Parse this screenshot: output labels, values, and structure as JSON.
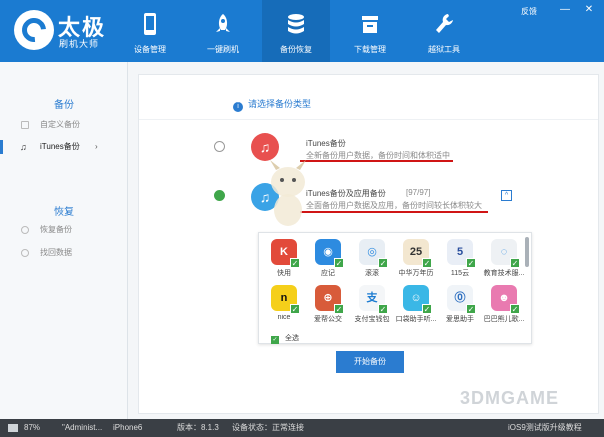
{
  "brand": {
    "title": "太极",
    "subtitle": "刷机大师"
  },
  "nav": [
    {
      "label": "设备管理",
      "icon": "phone-icon"
    },
    {
      "label": "一键刷机",
      "icon": "rocket-icon"
    },
    {
      "label": "备份恢复",
      "icon": "database-icon"
    },
    {
      "label": "下载管理",
      "icon": "download-box-icon"
    },
    {
      "label": "越狱工具",
      "icon": "wrench-icon"
    }
  ],
  "window": {
    "feedback": "反馈",
    "minimize": "—",
    "close": "✕"
  },
  "sidebar": {
    "backup_head": "备份",
    "backup_items": [
      {
        "label": "自定义备份",
        "icon": "checkbox-icon"
      },
      {
        "label": "iTunes备份",
        "icon": "music-note-icon",
        "chevron": "›"
      }
    ],
    "restore_head": "恢复",
    "restore_items": [
      {
        "label": "恢复备份",
        "icon": "circle-icon"
      },
      {
        "label": "找回数据",
        "icon": "circle-icon"
      }
    ]
  },
  "main": {
    "info": "请选择备份类型",
    "option1": {
      "title": "iTunes备份",
      "desc": "全新备份用户数据，备份时间和体积适中"
    },
    "option2": {
      "title": "iTunes备份及应用备份",
      "count": "[97/97]",
      "desc": "全面备份用户数据及应用，备份时间较长体积较大"
    },
    "apps_row1": [
      "快用",
      "应记",
      "滚滚",
      "中华万年历",
      "115云",
      "教育技术服..."
    ],
    "apps_row2": [
      "nice",
      "爱帮公交",
      "支付宝钱包",
      "口袋助手听...",
      "爱思助手",
      "巴巴熊儿歌..."
    ],
    "select_all": "全选",
    "start_button": "开始备份"
  },
  "status": {
    "battery": "87%",
    "device_name": "\"Administ...",
    "device_model": "iPhone6",
    "version": "版本：8.1.3",
    "device_state": "设备状态：正常连接",
    "right_text": "iOS9测试版升级教程"
  },
  "watermark": "3DMGAME",
  "colors": {
    "header": "#1b7bd1",
    "accent": "#2b7cd0",
    "check": "#3fa64a",
    "underline": "#d01515",
    "status_bar": "#3a3f45"
  }
}
